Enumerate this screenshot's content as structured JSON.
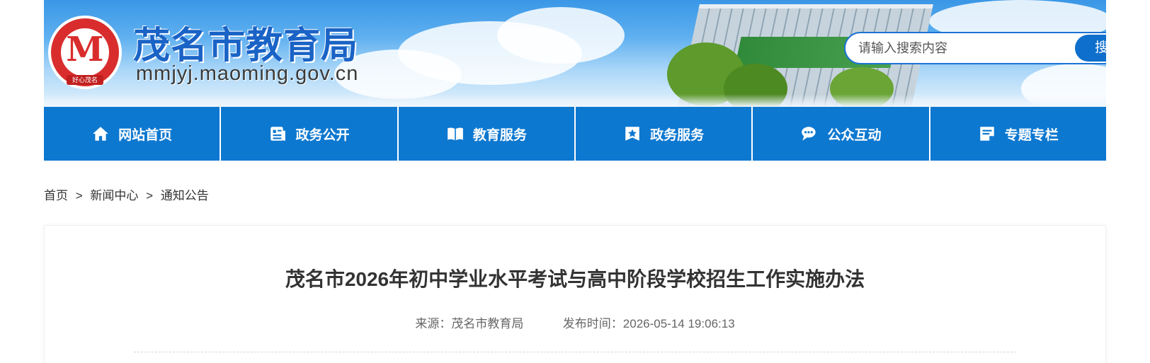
{
  "header": {
    "site_title": "茂名市教育局",
    "site_domain": "mmjyj.maoming.gov.cn",
    "logo": {
      "icon": "maoming-logo-icon",
      "ribbon_text": "好心茂名",
      "colors": {
        "red": "#d92d2d"
      }
    }
  },
  "search": {
    "placeholder": "请输入搜索内容",
    "button_label": "搜索"
  },
  "nav": {
    "items": [
      {
        "label": "网站首页",
        "icon": "home-icon"
      },
      {
        "label": "政务公开",
        "icon": "document-icon"
      },
      {
        "label": "教育服务",
        "icon": "book-icon"
      },
      {
        "label": "政务服务",
        "icon": "star-badge-icon"
      },
      {
        "label": "公众互动",
        "icon": "chat-icon"
      },
      {
        "label": "专题专栏",
        "icon": "note-icon"
      }
    ]
  },
  "breadcrumb": {
    "items": [
      "首页",
      "新闻中心",
      "通知公告"
    ],
    "separator": ">"
  },
  "article": {
    "title": "茂名市2026年初中学业水平考试与高中阶段学校招生工作实施办法",
    "source_label": "来源：",
    "source_value": "茂名市教育局",
    "date_label": "发布时间：",
    "date_value": "2026-05-14 19:06:13"
  },
  "theme": {
    "primary_blue": "#0d78d0",
    "title_blue": "#1a63c6"
  }
}
